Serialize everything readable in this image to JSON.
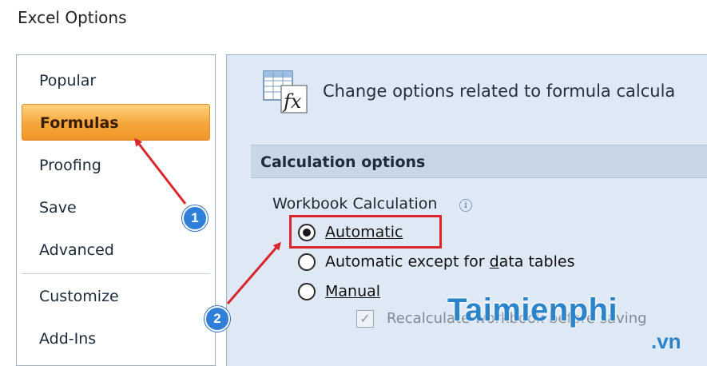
{
  "window": {
    "title": "Excel Options"
  },
  "sidebar": {
    "items": [
      {
        "label": "Popular"
      },
      {
        "label": "Formulas",
        "active": true
      },
      {
        "label": "Proofing"
      },
      {
        "label": "Save"
      },
      {
        "label": "Advanced"
      },
      {
        "label": "Customize"
      },
      {
        "label": "Add-Ins"
      }
    ]
  },
  "main": {
    "header_text": "Change options related to formula calcula",
    "section_title": "Calculation options",
    "workbook_calc": {
      "label": "Workbook Calculation",
      "info_glyph": "i",
      "options": [
        {
          "label": "Automatic",
          "checked": true
        },
        {
          "label_pre": "Automatic except for ",
          "label_underlined": "d",
          "label_post": "ata tables",
          "checked": false
        },
        {
          "label": "Manual",
          "checked": false
        }
      ],
      "recalc_checkbox": {
        "label": "Recalculate workbook before saving",
        "checked": true,
        "disabled": true
      }
    }
  },
  "annotations": {
    "badges": [
      "1",
      "2"
    ],
    "arrow_color": "#d9262c",
    "highlight_color": "#d9262c"
  },
  "watermark": {
    "text": "Taimienphi",
    "sub": ".vn",
    "color": "#2b84c9"
  },
  "colors": {
    "active_tab": "#f5a63a",
    "panel_bg": "#dfe9f5",
    "section_bg": "#c9d6e6"
  }
}
